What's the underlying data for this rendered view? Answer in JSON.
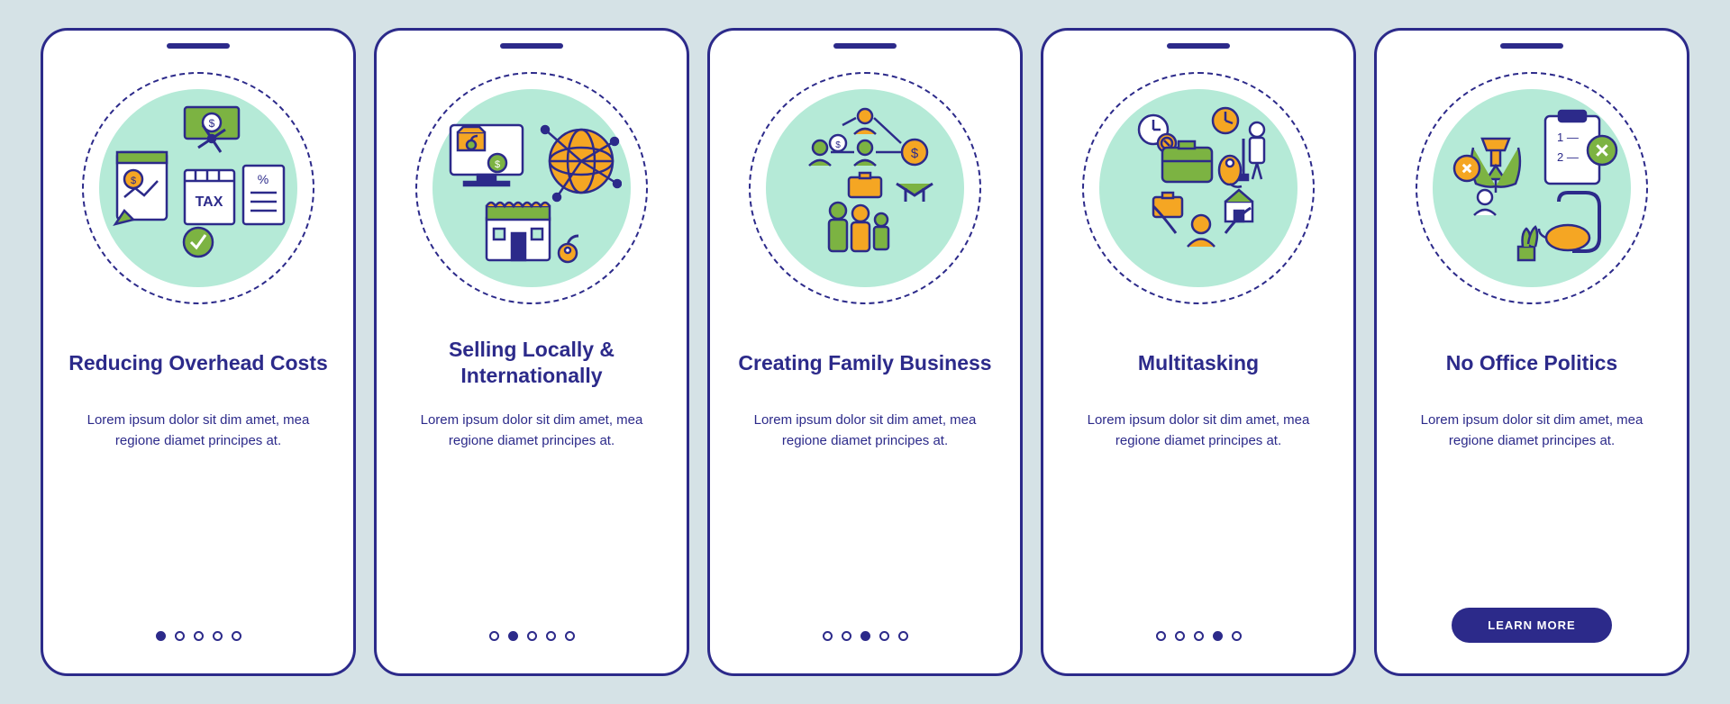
{
  "screens": [
    {
      "title": "Reducing Overhead Costs",
      "description": "Lorem ipsum dolor sit dim amet, mea regione diamet principes at.",
      "activeDot": 0,
      "showButton": false,
      "iconSet": "costs"
    },
    {
      "title": "Selling Locally & Internationally",
      "description": "Lorem ipsum dolor sit dim amet, mea regione diamet principes at.",
      "activeDot": 1,
      "showButton": false,
      "iconSet": "selling"
    },
    {
      "title": "Creating Family Business",
      "description": "Lorem ipsum dolor sit dim amet, mea regione diamet principes at.",
      "activeDot": 2,
      "showButton": false,
      "iconSet": "family"
    },
    {
      "title": "Multitasking",
      "description": "Lorem ipsum dolor sit dim amet, mea regione diamet principes at.",
      "activeDot": 3,
      "showButton": false,
      "iconSet": "multitask"
    },
    {
      "title": "No Office Politics",
      "description": "Lorem ipsum dolor sit dim amet, mea regione diamet principes at.",
      "activeDot": 4,
      "showButton": true,
      "iconSet": "politics"
    }
  ],
  "buttonLabel": "LEARN MORE",
  "totalDots": 5,
  "colors": {
    "primary": "#2c2a8a",
    "circleBg": "#b5ead7",
    "green": "#7cb342",
    "orange": "#f5a623"
  }
}
